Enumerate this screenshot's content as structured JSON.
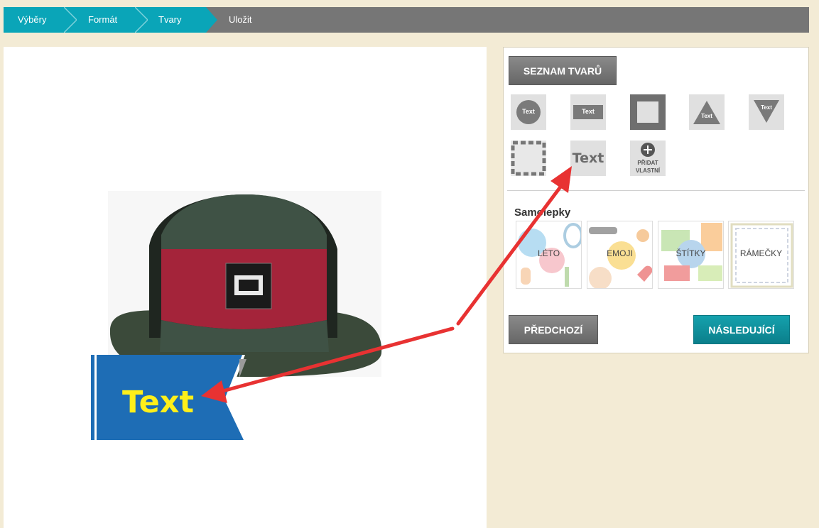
{
  "breadcrumb": {
    "items": [
      {
        "label": "Výběry"
      },
      {
        "label": "Formát"
      },
      {
        "label": "Tvary"
      },
      {
        "label": "Uložit"
      }
    ]
  },
  "canvas": {
    "label_text": "Text"
  },
  "panel": {
    "shapes_button": "SEZNAM TVARŮ",
    "shapes": {
      "circle_text": "Text",
      "rect_text": "Text",
      "triangle_text": "Text",
      "tri_down_text": "Text",
      "plain_text": "Text",
      "add_custom_line1": "PŘIDAT",
      "add_custom_line2": "VLASTNÍ"
    },
    "stickers_title": "Samolepky",
    "stickers": [
      {
        "label": "LÉTO"
      },
      {
        "label": "EMOJI"
      },
      {
        "label": "ŠTÍTKY"
      },
      {
        "label": "RÁMEČKY"
      }
    ],
    "prev_button": "PŘEDCHOZÍ",
    "next_button": "NÁSLEDUJÍCÍ"
  },
  "colors": {
    "accent_teal": "#0aa5b8",
    "arrow_red": "#e83232",
    "label_blue": "#1e6db5",
    "label_text_yellow": "#ffef1a"
  }
}
